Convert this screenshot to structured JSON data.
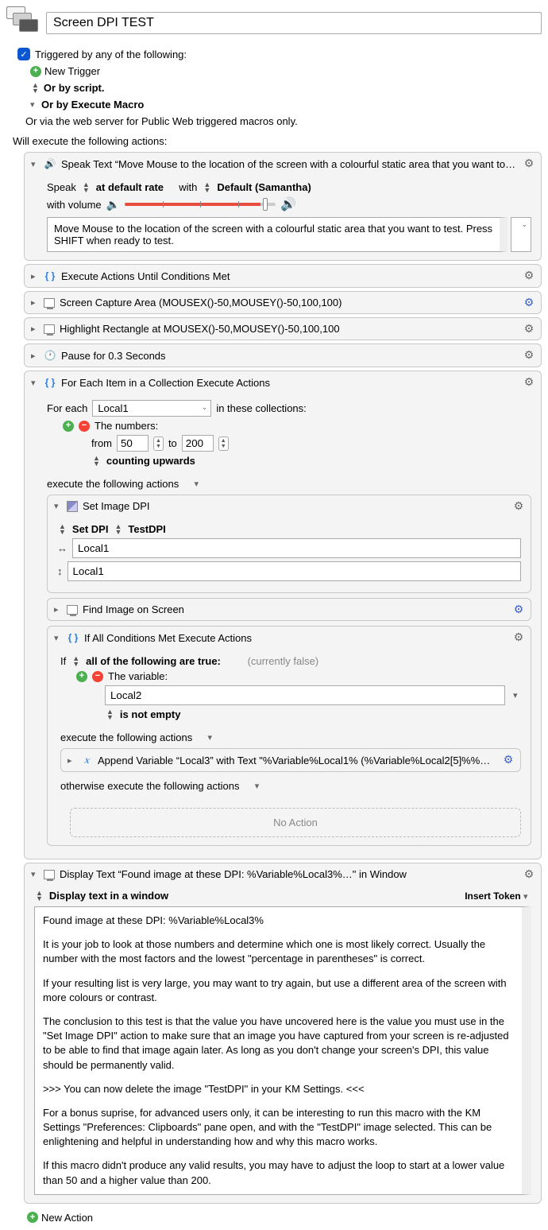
{
  "macro": {
    "title": "Screen DPI TEST"
  },
  "triggers": {
    "heading": "Triggered by any of the following:",
    "new_trigger": "New Trigger",
    "by_script": "Or by script.",
    "by_execute_macro": "Or by Execute Macro",
    "web_server": "Or via the web server for Public Web triggered macros only."
  },
  "exec_heading": "Will execute the following actions:",
  "a_speak": {
    "title": "Speak Text “Move Mouse to the location of the screen with a colourful static area that you want to…",
    "speak_label": "Speak",
    "rate": "at default rate",
    "with_label": "with",
    "voice": "Default (Samantha)",
    "volume_label": "with volume",
    "textarea": "Move Mouse to the location of the screen with a colourful static area that you want to test. Press SHIFT when ready to test."
  },
  "a_until": {
    "title": "Execute Actions Until Conditions Met"
  },
  "a_capture": {
    "title": "Screen Capture Area (MOUSEX()-50,MOUSEY()-50,100,100)"
  },
  "a_highlight": {
    "title": "Highlight Rectangle at MOUSEX()-50,MOUSEY()-50,100,100"
  },
  "a_pause": {
    "title": "Pause for 0.3 Seconds"
  },
  "a_foreach": {
    "title": "For Each Item in a Collection Execute Actions",
    "for_each": "For each",
    "var": "Local1",
    "in_collections": "in these collections:",
    "numbers_label": "The numbers:",
    "from_label": "from",
    "from_val": "50",
    "to_label": "to",
    "to_val": "200",
    "counting": "counting upwards",
    "exec_label": "execute the following actions"
  },
  "a_setdpi": {
    "title": "Set Image DPI",
    "set_dpi": "Set DPI",
    "testdpi": "TestDPI",
    "h_val": "Local1",
    "v_val": "Local1"
  },
  "a_findimg": {
    "title": "Find Image on Screen"
  },
  "a_ifall": {
    "title": "If All Conditions Met Execute Actions",
    "if_label": "If",
    "all_true": "all of the following are true:",
    "currently": "(currently false)",
    "var_label": "The variable:",
    "var_val": "Local2",
    "not_empty": "is not empty",
    "exec_label": "execute the following actions",
    "otherwise": "otherwise execute the following actions"
  },
  "a_append": {
    "title": "Append Variable “Local3” with Text \"%Variable%Local1% (%Variable%Local2[5]%%…"
  },
  "no_action": "No Action",
  "a_display": {
    "title": "Display Text “Found image at these DPI: %Variable%Local3%…\" in Window",
    "mode": "Display text in a window",
    "insert_token": "Insert Token",
    "p1": "Found image at these DPI: %Variable%Local3%",
    "p2": "It is your job to look at those numbers and determine which one is most likely correct. Usually the number with the most factors and the lowest \"percentage in parentheses\" is correct.",
    "p3": "If your resulting list is very large, you may want to try again, but use a different area of the screen with more colours or contrast.",
    "p4": "The conclusion to this test is that the value you have uncovered here is the value you must use in the \"Set Image DPI\" action to make sure that an image you have captured from your screen is re-adjusted to be able to find that image again later. As long as you don't change your screen's DPI, this value should be permanently valid.",
    "p5": ">>> You can now delete the image \"TestDPI\" in your KM Settings. <<<",
    "p6": "For a bonus suprise, for advanced users only, it can be interesting to run this macro with the KM Settings \"Preferences: Clipboards\" pane open, and with the \"TestDPI\" image selected. This can be enlightening and helpful in understanding how and why this macro works.",
    "p7": "If this macro didn't produce any valid results, you may have to adjust the loop to start at a lower value than 50 and a higher value than 200."
  },
  "new_action": "New Action"
}
